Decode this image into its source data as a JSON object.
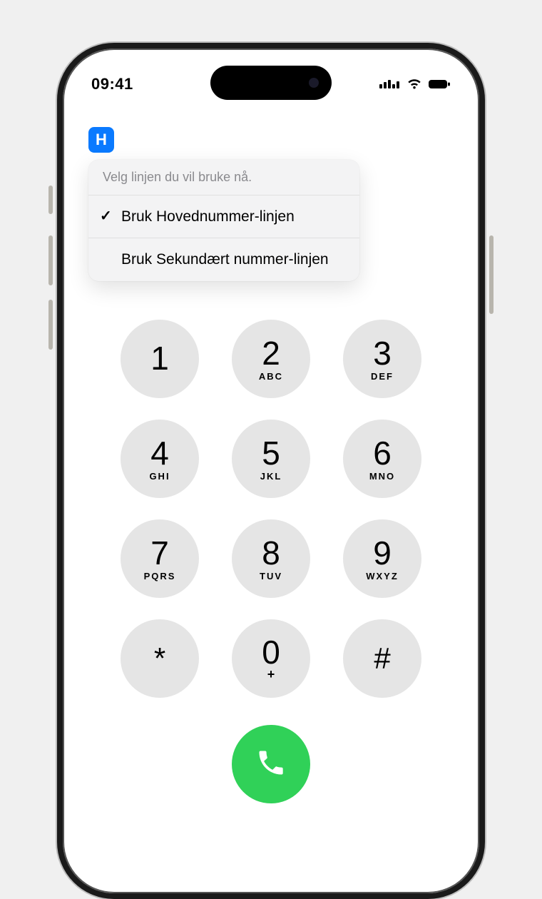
{
  "status": {
    "time": "09:41",
    "signal_label": "dual-sim-signal"
  },
  "line_badge": {
    "letter": "H"
  },
  "popover": {
    "title": "Velg linjen du vil bruke nå.",
    "options": [
      {
        "label": "Bruk Hovednummer-linjen",
        "selected": true
      },
      {
        "label": "Bruk Sekundært nummer-linjen",
        "selected": false
      }
    ]
  },
  "keypad": [
    {
      "digit": "1",
      "letters": ""
    },
    {
      "digit": "2",
      "letters": "ABC"
    },
    {
      "digit": "3",
      "letters": "DEF"
    },
    {
      "digit": "4",
      "letters": "GHI"
    },
    {
      "digit": "5",
      "letters": "JKL"
    },
    {
      "digit": "6",
      "letters": "MNO"
    },
    {
      "digit": "7",
      "letters": "PQRS"
    },
    {
      "digit": "8",
      "letters": "TUV"
    },
    {
      "digit": "9",
      "letters": "WXYZ"
    },
    {
      "digit": "*",
      "letters": ""
    },
    {
      "digit": "0",
      "letters": "+"
    },
    {
      "digit": "#",
      "letters": ""
    }
  ],
  "call_button": {
    "label": "call"
  }
}
